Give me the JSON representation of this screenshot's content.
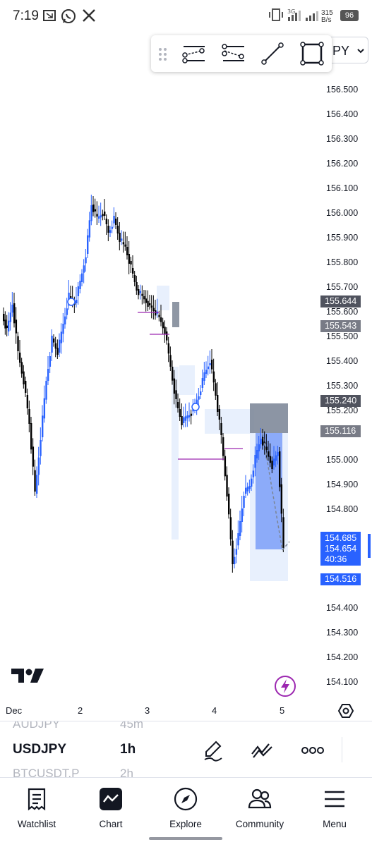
{
  "status_bar": {
    "time": "7:19",
    "net_speed_value": "315",
    "net_speed_unit": "B/s",
    "battery": "96",
    "icons": [
      "screenshot-icon",
      "whatsapp-icon",
      "x-icon",
      "vibrate-icon",
      "signal-3g-icon",
      "signal-icon",
      "signal-icon",
      "battery-icon"
    ]
  },
  "drawing_toolbar": {
    "tools": [
      "drag-handle-icon",
      "parallel-channel-icon",
      "regression-trend-icon",
      "trend-line-icon",
      "rectangle-icon"
    ]
  },
  "symbol_chip": {
    "text": "PY"
  },
  "price_axis": {
    "labels": [
      "156.500",
      "156.400",
      "156.300",
      "156.200",
      "156.100",
      "156.000",
      "155.900",
      "155.800",
      "155.700",
      "155.600",
      "155.500",
      "155.400",
      "155.300",
      "155.200",
      "155.000",
      "154.900",
      "154.800",
      "154.400",
      "154.300",
      "154.200",
      "154.100"
    ],
    "tags": [
      {
        "value": "155.644",
        "color": "#50535e"
      },
      {
        "value": "155.543",
        "color": "#787b86"
      },
      {
        "value": "155.240",
        "color": "#50535e"
      },
      {
        "value": "155.116",
        "color": "#787b86"
      },
      {
        "value": "154.516",
        "color": "#2962ff"
      }
    ],
    "current": {
      "price": "154.685",
      "last": "154.654",
      "countdown": "40:36",
      "color": "#2962ff"
    }
  },
  "time_axis": {
    "labels": [
      "Dec",
      "2",
      "3",
      "4",
      "5"
    ]
  },
  "chart_colors": {
    "up": "#2962ff",
    "down": "#000000",
    "zone": "#d6e4fb",
    "zone_dark": "#7b8594"
  },
  "brand": {
    "logo": "tradingview-logo-icon"
  },
  "ticker_strip": {
    "ghost_above": {
      "symbol": "AUDJPY",
      "tf": "45m"
    },
    "current": {
      "symbol": "USDJPY",
      "tf": "1h"
    },
    "ghost_below": {
      "symbol": "BTCUSDT.P",
      "tf": "2h"
    },
    "icons": [
      "pen-icon",
      "indicators-icon",
      "more-icon"
    ]
  },
  "bottom_nav": {
    "items": [
      {
        "label": "Watchlist",
        "icon": "watchlist-icon"
      },
      {
        "label": "Chart",
        "icon": "chart-icon"
      },
      {
        "label": "Explore",
        "icon": "compass-icon"
      },
      {
        "label": "Community",
        "icon": "community-icon"
      },
      {
        "label": "Menu",
        "icon": "menu-icon"
      }
    ]
  }
}
